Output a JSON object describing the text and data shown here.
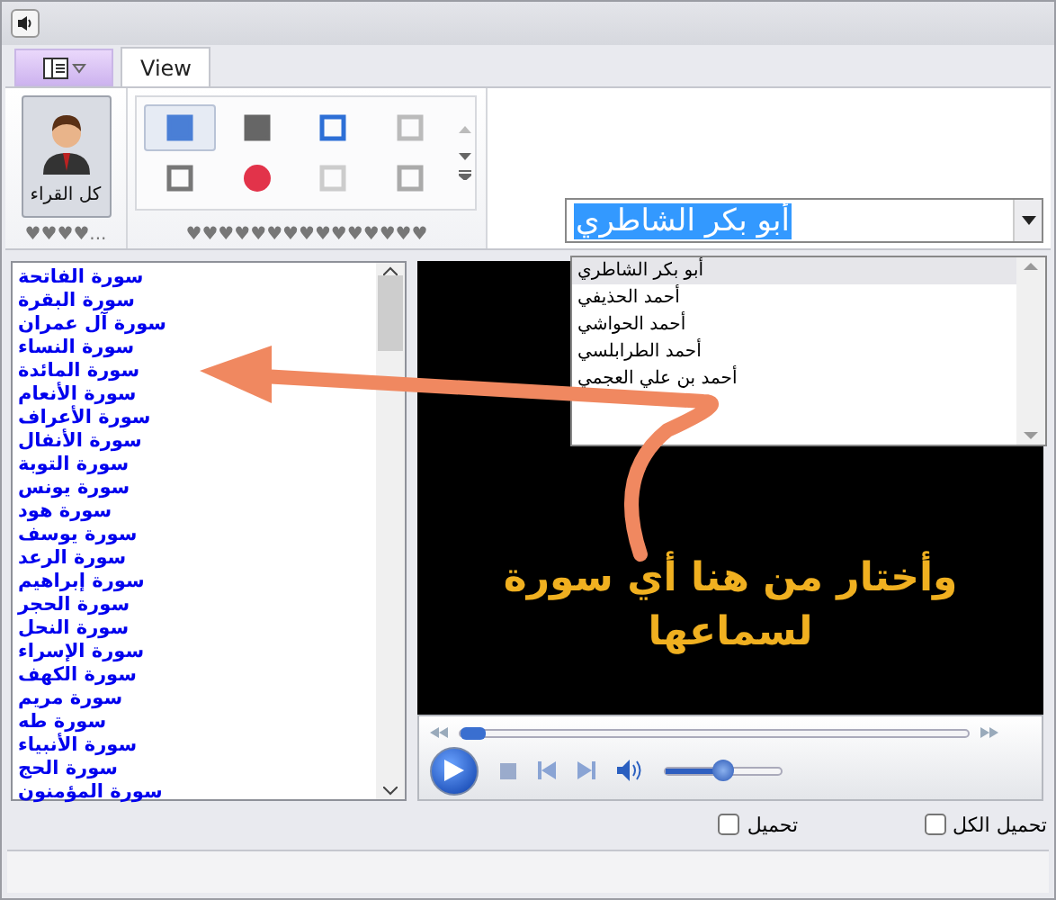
{
  "ribbon": {
    "tabs": [
      {
        "label": "View",
        "selected": true
      }
    ],
    "readers_group": {
      "button_label": "كل القراء",
      "footer": "♥♥♥♥..."
    },
    "gallery_group": {
      "footer": "♥♥♥♥♥♥♥♥♥♥♥♥♥♥♥",
      "items": [
        {
          "selected": true
        },
        {
          "selected": false
        },
        {
          "selected": false
        },
        {
          "selected": false
        },
        {
          "selected": false
        },
        {
          "selected": false
        },
        {
          "selected": false
        },
        {
          "selected": false
        }
      ]
    }
  },
  "reciter_combo": {
    "value": "أبو بكر الشاطري",
    "options": [
      {
        "label": "أبو بكر الشاطري",
        "selected": true
      },
      {
        "label": "أحمد الحذيفي",
        "selected": false
      },
      {
        "label": "أحمد الحواشي",
        "selected": false
      },
      {
        "label": "أحمد الطرابلسي",
        "selected": false
      },
      {
        "label": "أحمد بن علي العجمي",
        "selected": false
      }
    ]
  },
  "surah_list": [
    "سورة الفاتحة",
    "سورة البقرة",
    "سورة آل عمران",
    "سورة النساء",
    "سورة المائدة",
    "سورة الأنعام",
    "سورة الأعراف",
    "سورة الأنفال",
    "سورة التوبة",
    "سورة يونس",
    "سورة هود",
    "سورة يوسف",
    "سورة الرعد",
    "سورة إبراهيم",
    "سورة الحجر",
    "سورة النحل",
    "سورة الإسراء",
    "سورة الكهف",
    "سورة مريم",
    "سورة طه",
    "سورة الأنبياء",
    "سورة الحج",
    "سورة المؤمنون"
  ],
  "video_caption": [
    "وأختار من هنا أي سورة",
    "لسماعها"
  ],
  "player": {
    "seek": {
      "level": 0.02
    },
    "volume": {
      "level": 0.5
    }
  },
  "checkboxes": [
    {
      "label": "تحميل الكل",
      "checked": false
    },
    {
      "label": "تحميل",
      "checked": false
    }
  ]
}
